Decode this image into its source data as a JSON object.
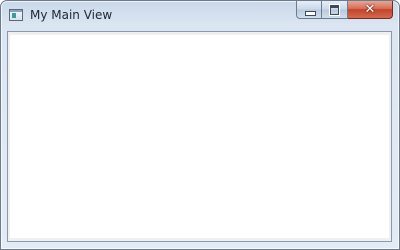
{
  "window": {
    "title": "My Main View"
  },
  "caption_buttons": {
    "minimize_icon": "minimize-icon",
    "maximize_icon": "maximize-icon",
    "close_icon": "close-icon",
    "close_glyph": "✕"
  },
  "colors": {
    "close_button": "#c1442b",
    "client_background": "#ffffff",
    "frame": "#dce6f2"
  }
}
